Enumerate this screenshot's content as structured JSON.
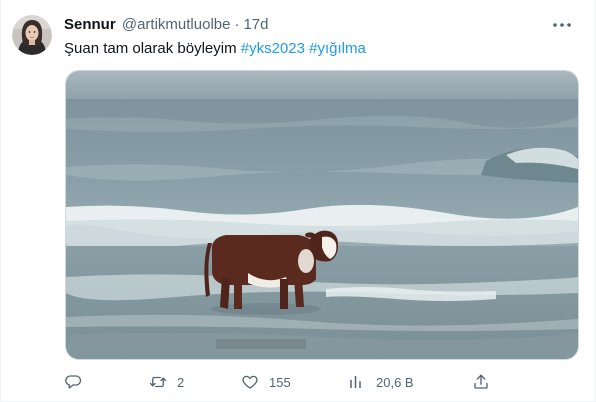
{
  "user": {
    "display_name": "Sennur",
    "handle": "@artikmutluolbe",
    "separator": "·",
    "timestamp": "17d"
  },
  "tweet": {
    "text_plain": "Şuan tam olarak böyleyim",
    "hashtags": [
      "#yks2023",
      "#yığılma"
    ]
  },
  "icons": {
    "more": "more-horizontal-icon",
    "reply": "reply-icon",
    "retweet": "retweet-icon",
    "like": "heart-icon",
    "views": "analytics-icon",
    "share": "share-icon"
  },
  "actions": {
    "reply_count": "",
    "retweet_count": "2",
    "like_count": "155",
    "views_count": "20,6 B"
  },
  "colors": {
    "accent": "#1d9bf0",
    "text_primary": "#0f1419",
    "text_secondary": "#536471",
    "border": "#cfd9de"
  }
}
